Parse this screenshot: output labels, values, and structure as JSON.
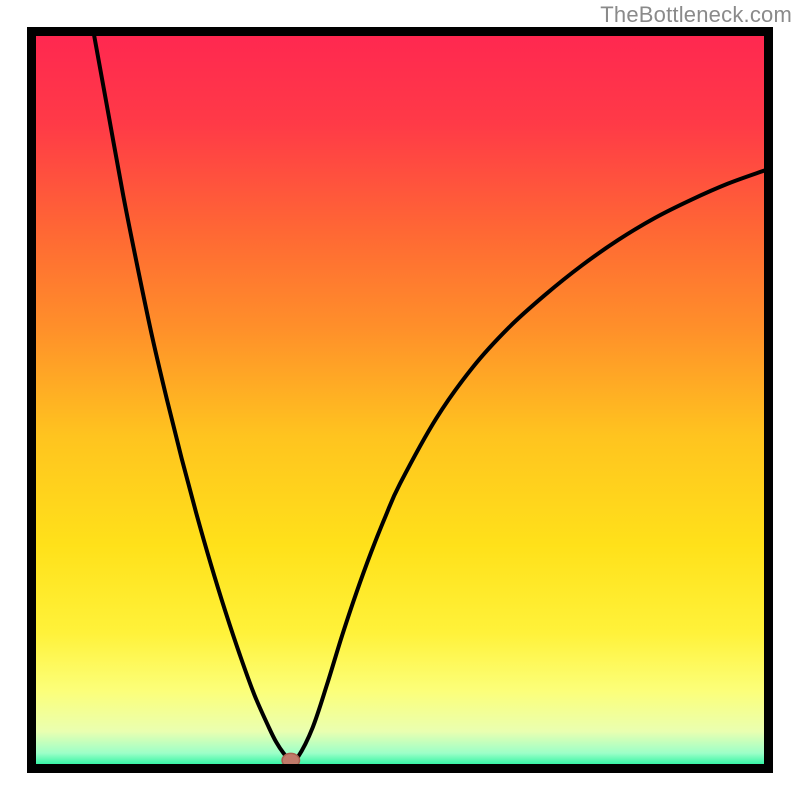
{
  "watermark": "TheBottleneck.com",
  "colors": {
    "frame": "#000000",
    "curve": "#000000",
    "marker_fill": "#c07a6a",
    "marker_stroke": "#a9614f"
  },
  "gradient_stops": [
    {
      "offset": 0.0,
      "color": "#ff2850"
    },
    {
      "offset": 0.12,
      "color": "#ff3a47"
    },
    {
      "offset": 0.28,
      "color": "#ff6b33"
    },
    {
      "offset": 0.4,
      "color": "#ff8f2a"
    },
    {
      "offset": 0.55,
      "color": "#ffc41f"
    },
    {
      "offset": 0.7,
      "color": "#ffe11a"
    },
    {
      "offset": 0.82,
      "color": "#fff23a"
    },
    {
      "offset": 0.9,
      "color": "#fcff7a"
    },
    {
      "offset": 0.955,
      "color": "#eaffb0"
    },
    {
      "offset": 0.985,
      "color": "#9dffc8"
    },
    {
      "offset": 1.0,
      "color": "#38f5a6"
    }
  ],
  "chart_data": {
    "type": "line",
    "title": "",
    "xlabel": "",
    "ylabel": "",
    "xlim": [
      0,
      100
    ],
    "ylim": [
      0,
      100
    ],
    "grid": false,
    "legend": false,
    "x": [
      8,
      10,
      12,
      14,
      16,
      18,
      20,
      22,
      24,
      26,
      28,
      30,
      32,
      33,
      34,
      35,
      36,
      38,
      40,
      42,
      44,
      46,
      48,
      50,
      55,
      60,
      65,
      70,
      75,
      80,
      85,
      90,
      95,
      100
    ],
    "values": [
      100,
      89,
      78,
      68,
      58.5,
      50,
      42,
      34.5,
      27.5,
      21,
      15,
      9.5,
      5,
      3,
      1.5,
      0.5,
      1,
      5,
      11,
      17.5,
      23.5,
      29,
      34,
      38.5,
      47.5,
      54.5,
      60,
      64.5,
      68.5,
      72,
      75,
      77.5,
      79.7,
      81.5
    ],
    "marker": {
      "x": 35,
      "y": 0.5,
      "r": 1.2
    },
    "annotations": []
  }
}
